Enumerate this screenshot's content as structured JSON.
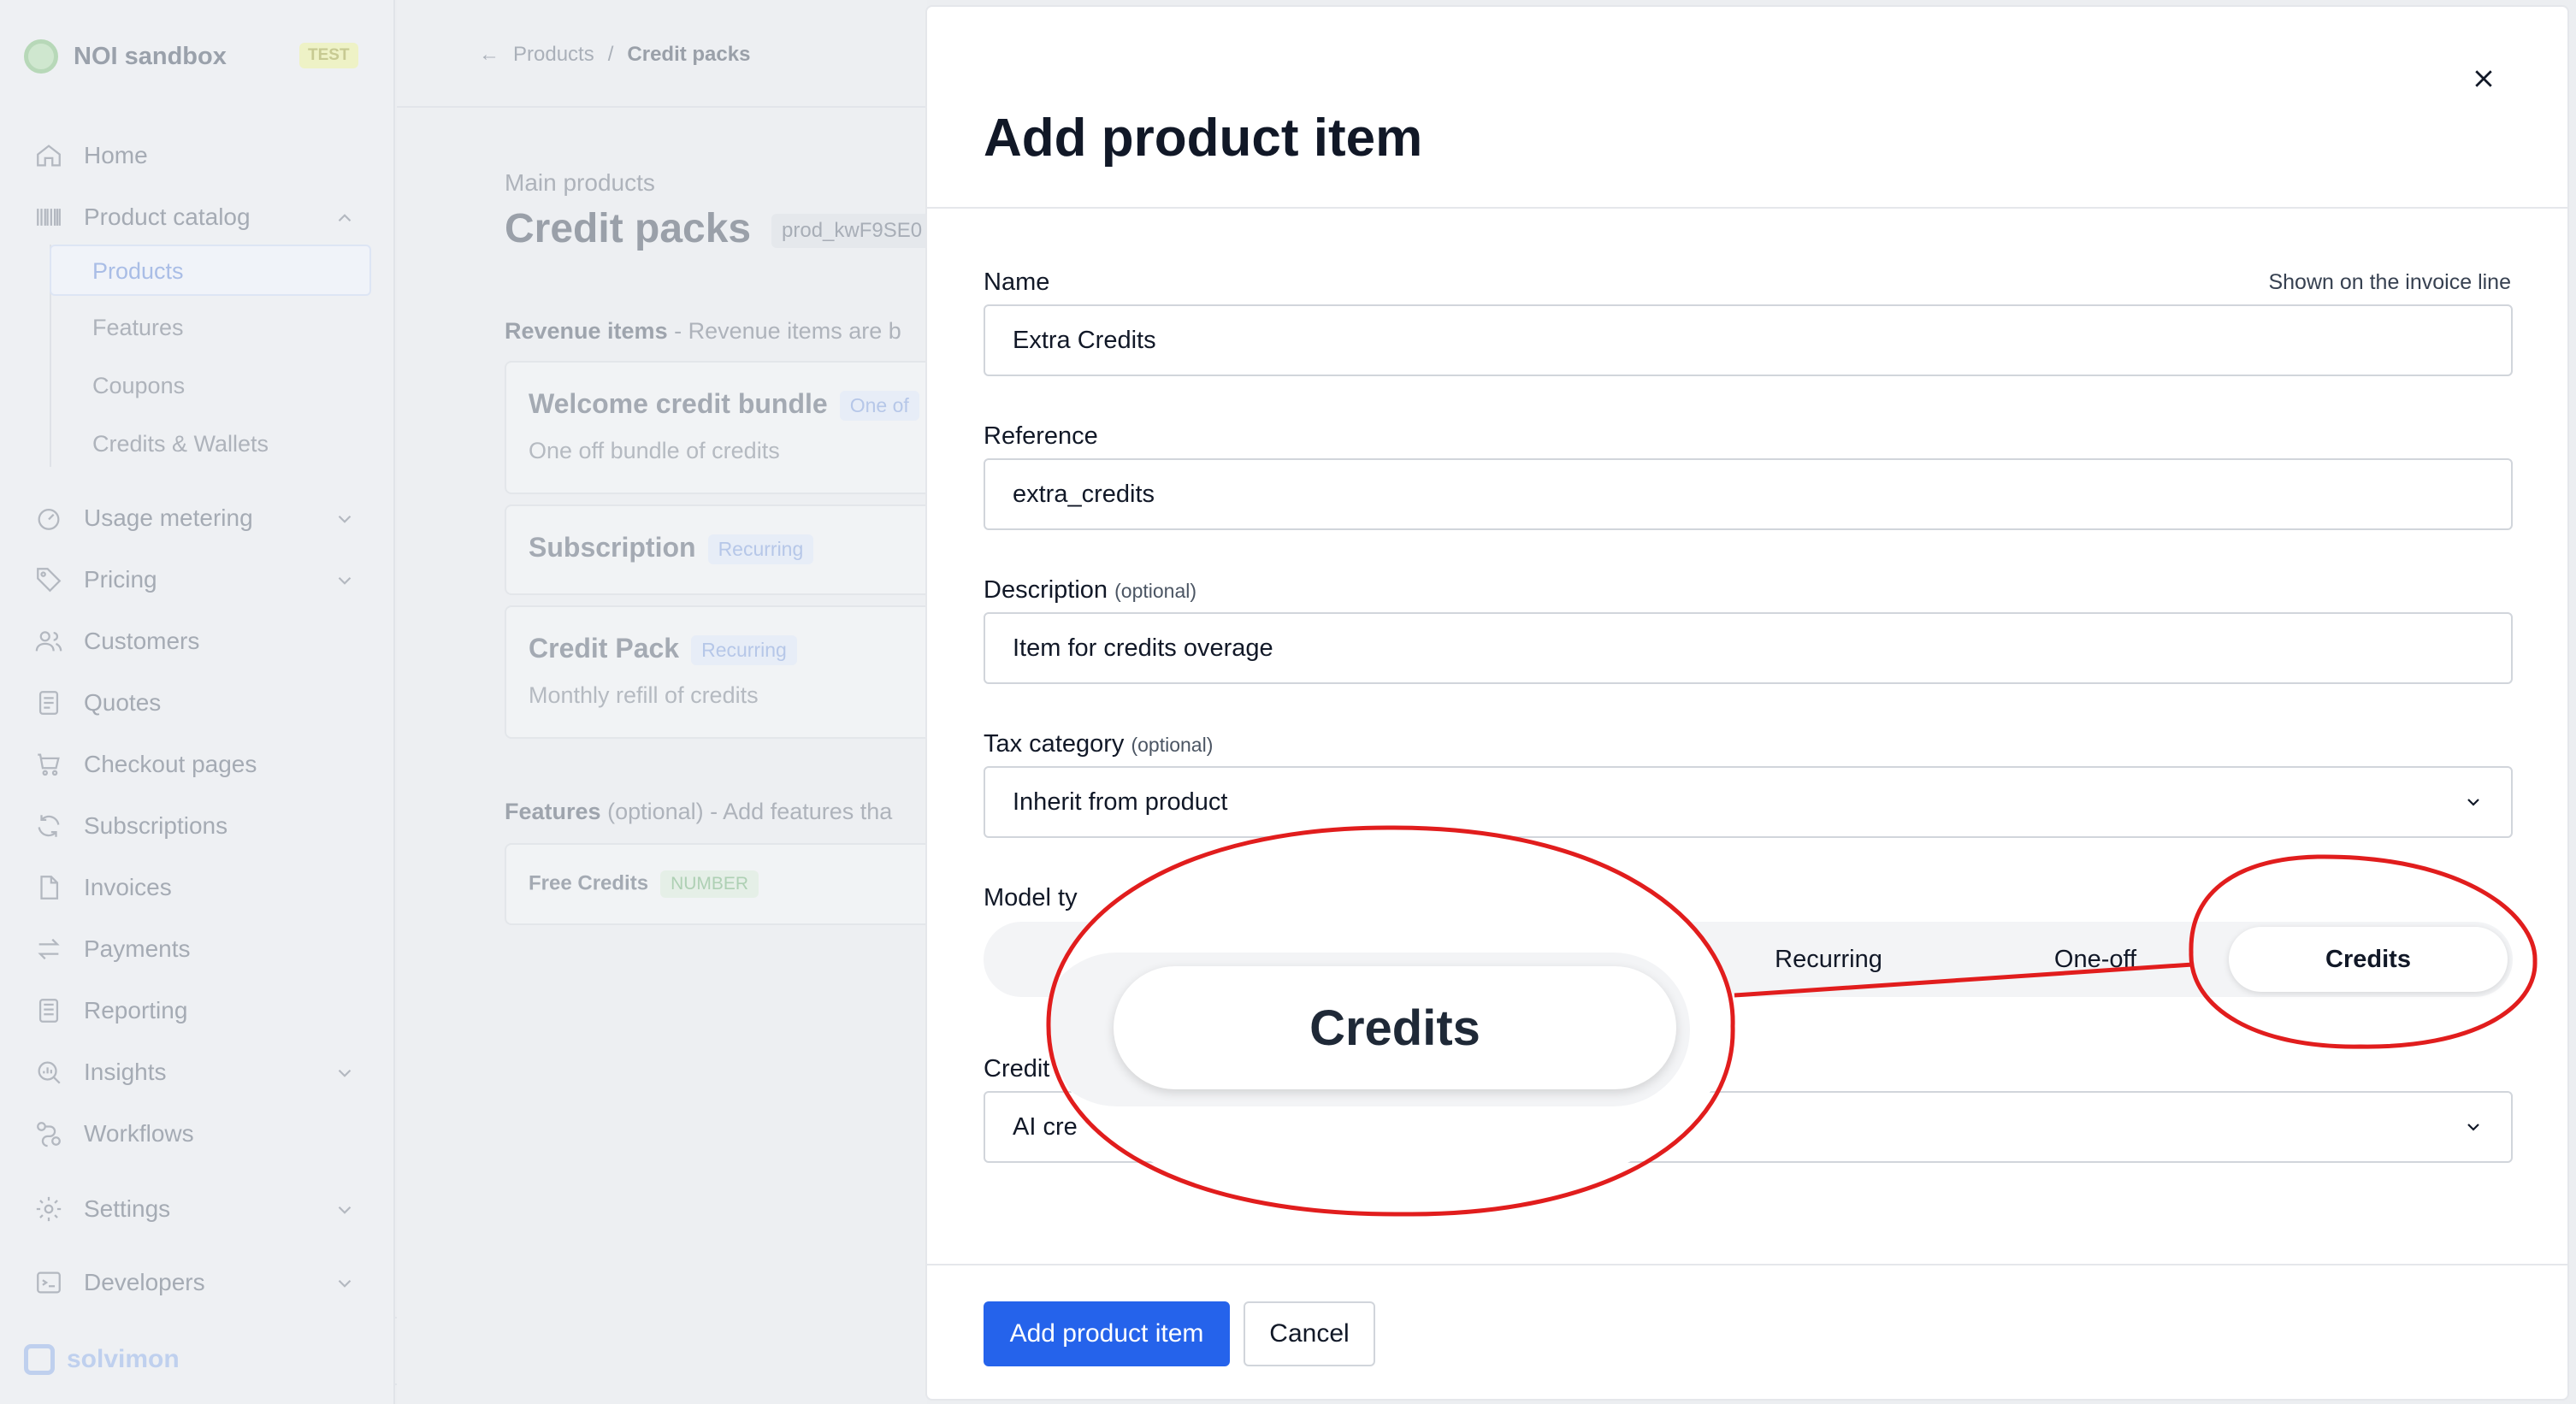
{
  "workspace": {
    "name": "NOI sandbox",
    "env_badge": "TEST"
  },
  "sidebar": {
    "items": [
      {
        "label": "Home",
        "icon": "home-icon"
      },
      {
        "label": "Product catalog",
        "icon": "barcode-icon"
      },
      {
        "label": "Usage metering",
        "icon": "gauge-icon"
      },
      {
        "label": "Pricing",
        "icon": "tag-icon"
      },
      {
        "label": "Customers",
        "icon": "users-icon"
      },
      {
        "label": "Quotes",
        "icon": "document-icon"
      },
      {
        "label": "Checkout pages",
        "icon": "cart-icon"
      },
      {
        "label": "Subscriptions",
        "icon": "refresh-icon"
      },
      {
        "label": "Invoices",
        "icon": "file-icon"
      },
      {
        "label": "Payments",
        "icon": "arrows-icon"
      },
      {
        "label": "Reporting",
        "icon": "report-icon"
      },
      {
        "label": "Insights",
        "icon": "insights-icon"
      },
      {
        "label": "Workflows",
        "icon": "workflow-icon"
      },
      {
        "label": "Settings",
        "icon": "gear-icon"
      },
      {
        "label": "Developers",
        "icon": "terminal-icon"
      }
    ],
    "catalog_sub": [
      "Products",
      "Features",
      "Coupons",
      "Credits & Wallets"
    ],
    "footer_brand": "solvimon"
  },
  "main": {
    "breadcrumb": {
      "parent": "Products",
      "separator": "/",
      "current": "Credit packs"
    },
    "subtitle": "Main products",
    "title": "Credit packs",
    "product_id": "prod_kwF9SE0",
    "revenue_label": "Revenue items",
    "revenue_hint": "- Revenue items are b",
    "cards": [
      {
        "title": "Welcome credit bundle",
        "badge": "One of",
        "desc": "One off bundle of credits"
      },
      {
        "title": "Subscription",
        "badge": "Recurring",
        "desc": ""
      },
      {
        "title": "Credit Pack",
        "badge": "Recurring",
        "desc": "Monthly refill of credits"
      }
    ],
    "features_label": "Features",
    "features_optional": "(optional)",
    "features_hint": "- Add features tha",
    "feature_card": {
      "title": "Free Credits",
      "badge": "NUMBER"
    }
  },
  "modal": {
    "title": "Add product item",
    "name": {
      "label": "Name",
      "hint": "Shown on the invoice line",
      "value": "Extra Credits"
    },
    "reference": {
      "label": "Reference",
      "value": "extra_credits"
    },
    "description": {
      "label": "Description",
      "optional": "(optional)",
      "value": "Item for credits overage"
    },
    "tax": {
      "label": "Tax category",
      "optional": "(optional)",
      "value": "Inherit from product"
    },
    "model_type": {
      "label": "Model ty",
      "options": [
        "Recurring",
        "One-off",
        "Credits"
      ],
      "selected": "Credits"
    },
    "credit": {
      "label": "Credit",
      "value": "AI cre"
    },
    "actions": {
      "primary": "Add product item",
      "secondary": "Cancel"
    }
  },
  "annotation": {
    "zoom_text": "Credits",
    "color": "#e11d1d"
  }
}
